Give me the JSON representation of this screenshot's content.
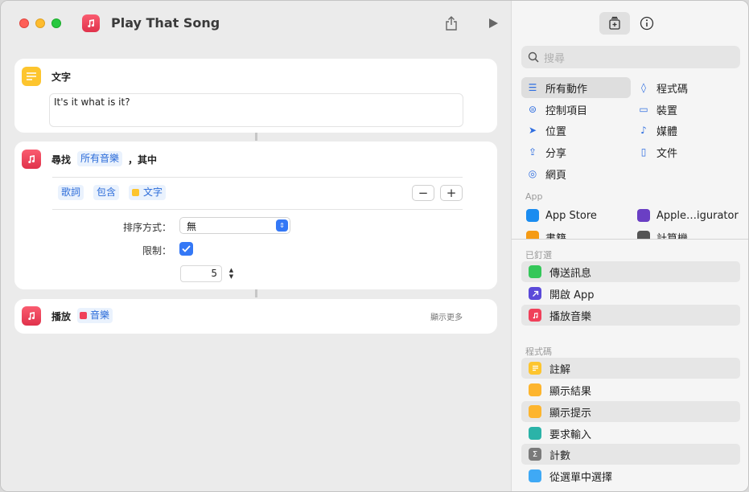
{
  "window": {
    "title": "Play That Song"
  },
  "actions": {
    "text_action": {
      "label": "文字",
      "content": "It's it what is it?"
    },
    "find_action": {
      "label": "尋找",
      "source_token": "所有音樂",
      "where": "，其中",
      "filter": {
        "field": "歌詞",
        "op": "包含",
        "value": "文字"
      },
      "sort_label": "排序方式：",
      "sort_value": "無",
      "limit_label": "限制：",
      "limit_value": "5"
    },
    "play_action": {
      "label": "播放",
      "token": "音樂",
      "more": "顯示更多"
    }
  },
  "sidebar": {
    "search_placeholder": "搜尋",
    "categories": [
      {
        "label": "所有動作",
        "icon": "list-icon"
      },
      {
        "label": "程式碼",
        "icon": "code-icon"
      },
      {
        "label": "控制項目",
        "icon": "toggle-icon"
      },
      {
        "label": "裝置",
        "icon": "display-icon"
      },
      {
        "label": "位置",
        "icon": "location-icon"
      },
      {
        "label": "媒體",
        "icon": "music-note-icon"
      },
      {
        "label": "分享",
        "icon": "share-icon"
      },
      {
        "label": "文件",
        "icon": "document-icon"
      },
      {
        "label": "網頁",
        "icon": "compass-icon"
      }
    ],
    "app_section": "App",
    "apps": [
      {
        "label": "App Store",
        "color": "#1a8cf0"
      },
      {
        "label": "Apple…igurator",
        "color": "#6a3fc4"
      },
      {
        "label": "書籍",
        "color": "#f59b15"
      },
      {
        "label": "計算機",
        "color": "#555555"
      }
    ],
    "pinned_section": "已釘選",
    "pinned": [
      {
        "label": "傳送訊息",
        "color": "#34c759"
      },
      {
        "label": "開啟 App",
        "color": "#5b4ad9"
      },
      {
        "label": "播放音樂",
        "color": "#f0405a"
      }
    ],
    "code_section": "程式碼",
    "code_items": [
      {
        "label": "註解",
        "color": "#fdc52e"
      },
      {
        "label": "顯示結果",
        "color": "#fdb52e"
      },
      {
        "label": "顯示提示",
        "color": "#fdb52e"
      },
      {
        "label": "要求輸入",
        "color": "#2bb3a8"
      },
      {
        "label": "計數",
        "color": "#7a7a7a"
      },
      {
        "label": "從選單中選擇",
        "color": "#3fa9f5"
      }
    ]
  }
}
